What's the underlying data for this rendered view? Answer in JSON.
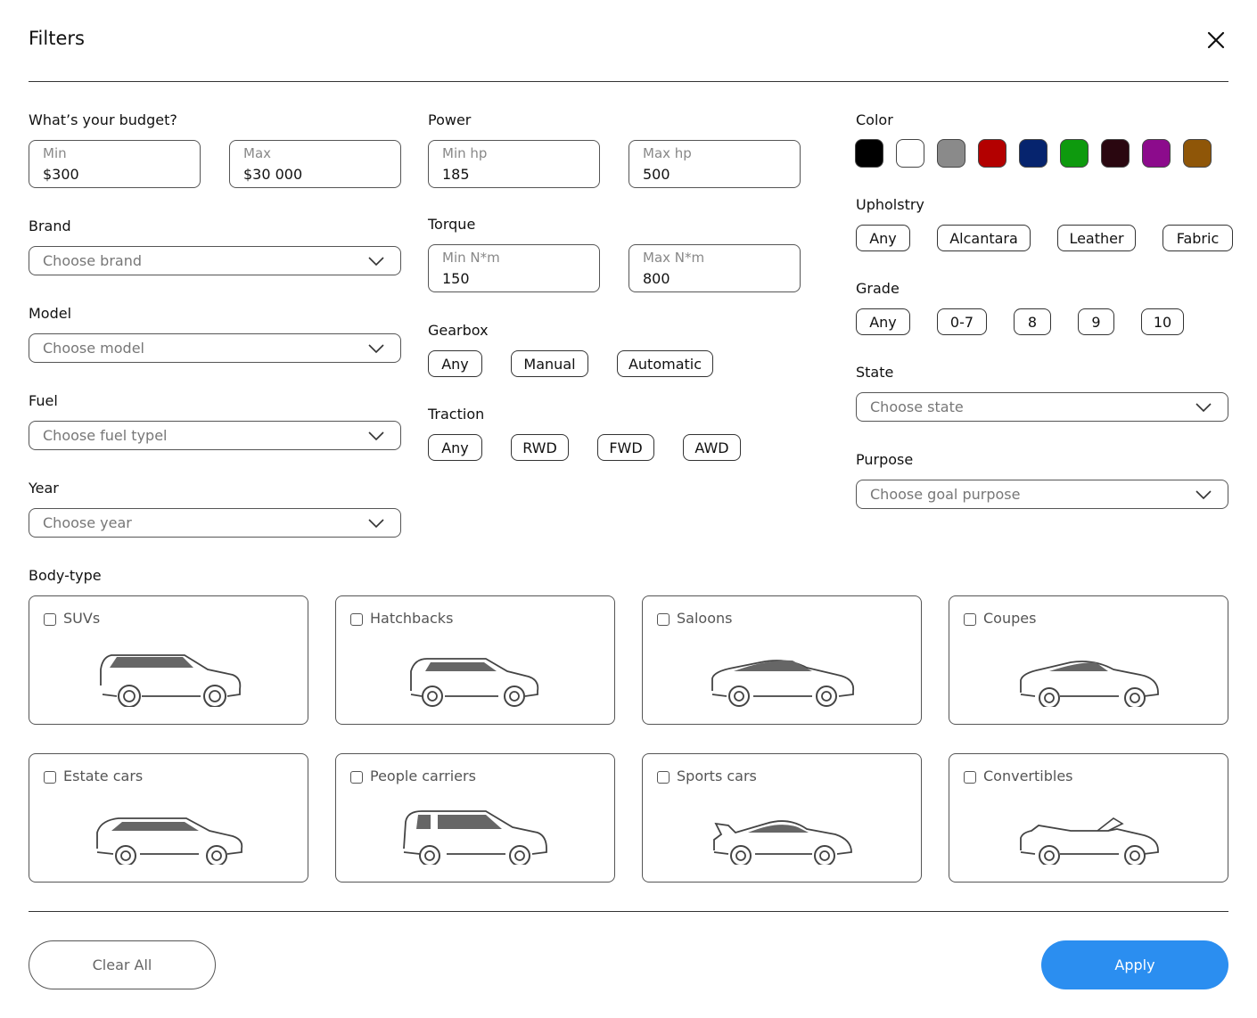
{
  "header": {
    "title": "Filters",
    "close_icon": "close-icon"
  },
  "budget": {
    "label": "What’s your budget?",
    "min_label": "Min",
    "min_value": "$300",
    "max_label": "Max",
    "max_value": "$30 000"
  },
  "brand": {
    "label": "Brand",
    "placeholder": "Choose brand"
  },
  "model": {
    "label": "Model",
    "placeholder": "Choose model"
  },
  "fuel": {
    "label": "Fuel",
    "placeholder": "Choose fuel typel"
  },
  "year": {
    "label": "Year",
    "placeholder": "Choose year"
  },
  "power": {
    "label": "Power",
    "min_label": "Min hp",
    "min_value": "185",
    "max_label": "Max hp",
    "max_value": "500"
  },
  "torque": {
    "label": "Torque",
    "min_label": "Min N*m",
    "min_value": "150",
    "max_label": "Max N*m",
    "max_value": "800"
  },
  "gearbox": {
    "label": "Gearbox",
    "options": [
      "Any",
      "Manual",
      "Automatic"
    ]
  },
  "traction": {
    "label": "Traction",
    "options": [
      "Any",
      "RWD",
      "FWD",
      "AWD"
    ]
  },
  "color": {
    "label": "Color",
    "swatches": [
      "#000000",
      "#ffffff",
      "#8a8a8a",
      "#b30000",
      "#06246e",
      "#0e9a0e",
      "#2a0710",
      "#8c0b8c",
      "#8f5608"
    ]
  },
  "upholstry": {
    "label": "Upholstry",
    "options": [
      "Any",
      "Alcantara",
      "Leather",
      "Fabric"
    ]
  },
  "grade": {
    "label": "Grade",
    "options": [
      "Any",
      "0-7",
      "8",
      "9",
      "10"
    ]
  },
  "state": {
    "label": "State",
    "placeholder": "Choose state"
  },
  "purpose": {
    "label": "Purpose",
    "placeholder": "Choose goal purpose"
  },
  "body_type": {
    "label": "Body-type",
    "items": [
      "SUVs",
      "Hatchbacks",
      "Saloons",
      "Coupes",
      "Estate cars",
      "People carriers",
      "Sports cars",
      "Convertibles"
    ]
  },
  "footer": {
    "clear_label": "Clear All",
    "apply_label": "Apply"
  },
  "colors": {
    "accent": "#2b8ef0"
  }
}
